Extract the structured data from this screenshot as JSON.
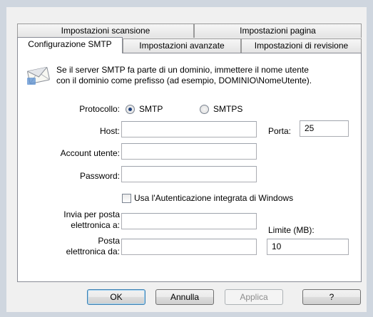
{
  "tabs": {
    "row1": [
      "Impostazioni scansione",
      "Impostazioni pagina"
    ],
    "row2": [
      "Configurazione SMTP",
      "Impostazioni avanzate",
      "Impostazioni di revisione"
    ]
  },
  "info": {
    "icon": "envelope-icon",
    "line1": "Se il server SMTP fa parte di un dominio, immettere il nome utente",
    "line2": "con il dominio come prefisso (ad esempio, DOMINIO\\NomeUtente)."
  },
  "protocol": {
    "label": "Protocollo:",
    "options": [
      "SMTP",
      "SMTPS"
    ],
    "selected": "SMTP"
  },
  "fields": {
    "host_label": "Host:",
    "host_value": "",
    "port_label": "Porta:",
    "port_value": "25",
    "account_label": "Account utente:",
    "account_value": "",
    "password_label": "Password:",
    "password_value": "",
    "windows_auth_label": "Usa l'Autenticazione integrata di Windows",
    "windows_auth_checked": false,
    "send_to_label_1": "Invia per posta",
    "send_to_label_2": "elettronica a:",
    "send_to_value": "",
    "from_label_1": "Posta",
    "from_label_2": "elettronica da:",
    "from_value": "",
    "limit_label": "Limite (MB):",
    "limit_value": "10"
  },
  "buttons": {
    "ok": "OK",
    "cancel": "Annulla",
    "apply": "Applica",
    "help": "?"
  }
}
